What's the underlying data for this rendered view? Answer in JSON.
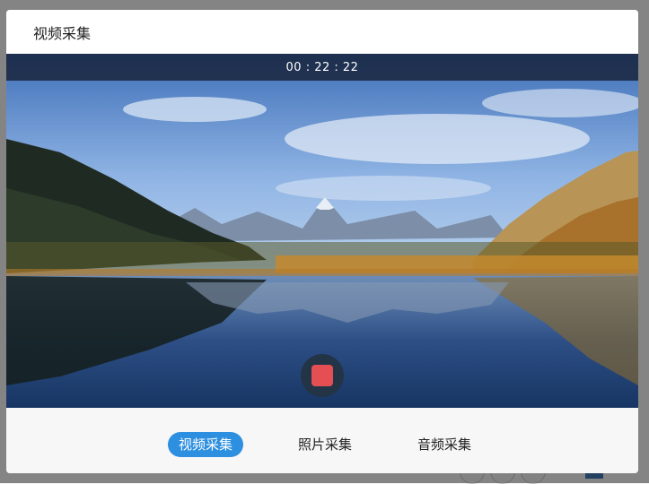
{
  "modal": {
    "title": "视频采集",
    "timer": "00 : 22 : 22",
    "record_button_state": "recording"
  },
  "modes": [
    {
      "label": "视频采集",
      "active": true
    },
    {
      "label": "照片采集",
      "active": false
    },
    {
      "label": "音频采集",
      "active": false
    }
  ],
  "colors": {
    "accent": "#2d8fe0",
    "record": "#e34f53",
    "record_ring": "#243447"
  }
}
